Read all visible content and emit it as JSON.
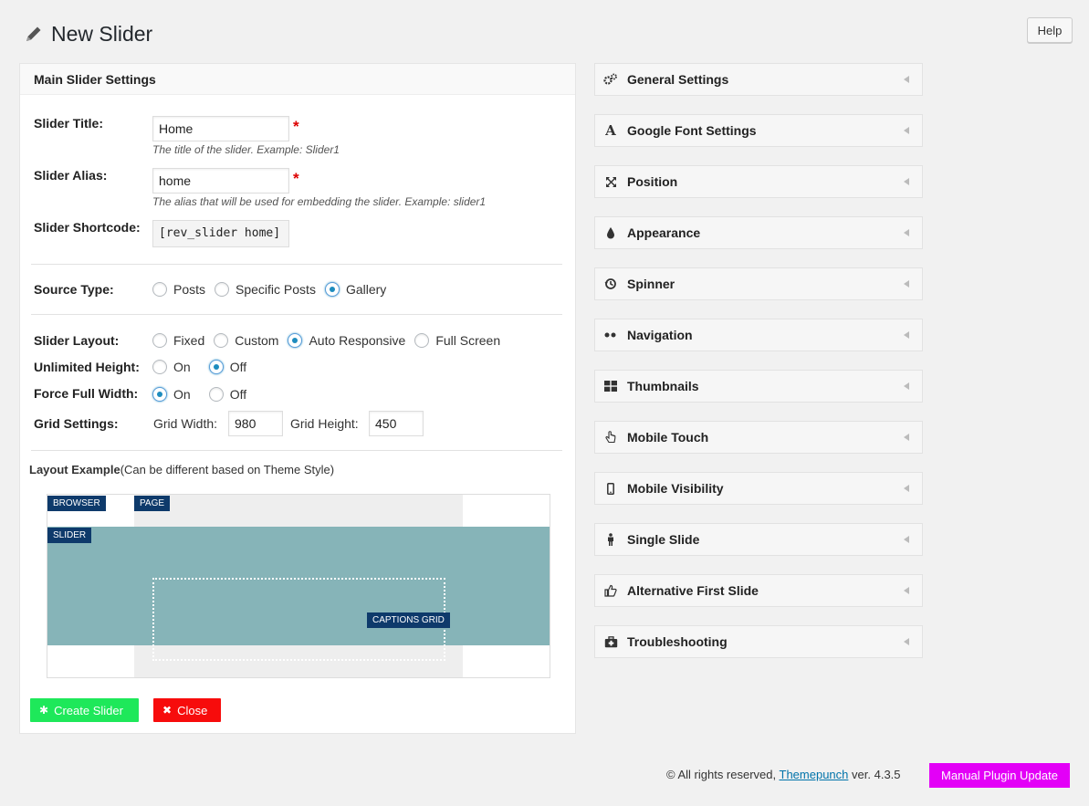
{
  "header": {
    "title": "New Slider",
    "help_label": "Help"
  },
  "main_panel": {
    "title": "Main Slider Settings",
    "slider_title": {
      "label": "Slider Title:",
      "value": "Home",
      "hint": "The title of the slider. Example: Slider1"
    },
    "slider_alias": {
      "label": "Slider Alias:",
      "value": "home",
      "hint": "The alias that will be used for embedding the slider. Example: slider1"
    },
    "shortcode": {
      "label": "Slider Shortcode:",
      "value": "[rev_slider home]"
    },
    "required_mark": "*",
    "source_type": {
      "label": "Source Type:",
      "options": [
        "Posts",
        "Specific Posts",
        "Gallery"
      ],
      "selected": "Gallery"
    },
    "slider_layout": {
      "label": "Slider Layout:",
      "options": [
        "Fixed",
        "Custom",
        "Auto Responsive",
        "Full Screen"
      ],
      "selected": "Auto Responsive"
    },
    "unlimited_height": {
      "label": "Unlimited Height:",
      "options": [
        "On",
        "Off"
      ],
      "selected": "Off"
    },
    "force_full_width": {
      "label": "Force Full Width:",
      "options": [
        "On",
        "Off"
      ],
      "selected": "On"
    },
    "grid_settings": {
      "label": "Grid Settings:",
      "width_label": "Grid Width:",
      "width_value": "980",
      "height_label": "Grid Height:",
      "height_value": "450"
    },
    "layout_example": {
      "title_bold": "Layout Example",
      "title_rest": "(Can be different based on Theme Style)",
      "tags": {
        "browser": "BROWSER",
        "page": "PAGE",
        "slider": "SLIDER",
        "captions": "CAPTIONS GRID"
      }
    },
    "buttons": {
      "create": "Create Slider",
      "close": "Close"
    }
  },
  "accordion": [
    {
      "label": "General Settings",
      "icon": "gears-icon"
    },
    {
      "label": "Google Font Settings",
      "icon": "font-icon"
    },
    {
      "label": "Position",
      "icon": "position-icon"
    },
    {
      "label": "Appearance",
      "icon": "drop-icon"
    },
    {
      "label": "Spinner",
      "icon": "spinner-icon"
    },
    {
      "label": "Navigation",
      "icon": "dots-icon"
    },
    {
      "label": "Thumbnails",
      "icon": "grid-icon"
    },
    {
      "label": "Mobile Touch",
      "icon": "hand-icon"
    },
    {
      "label": "Mobile Visibility",
      "icon": "mobile-icon"
    },
    {
      "label": "Single Slide",
      "icon": "person-icon"
    },
    {
      "label": "Alternative First Slide",
      "icon": "thumbs-up-icon"
    },
    {
      "label": "Troubleshooting",
      "icon": "medkit-icon"
    }
  ],
  "footer": {
    "text_before": "© All rights reserved,",
    "link": "Themepunch",
    "text_after": "ver. 4.3.5",
    "update_button": "Manual Plugin Update"
  },
  "colors": {
    "create": "#1ee85a",
    "close": "#f70c0c",
    "update": "#e300f7",
    "slider_bg": "#86b4b8",
    "tag_bg": "#0e3a6b"
  }
}
